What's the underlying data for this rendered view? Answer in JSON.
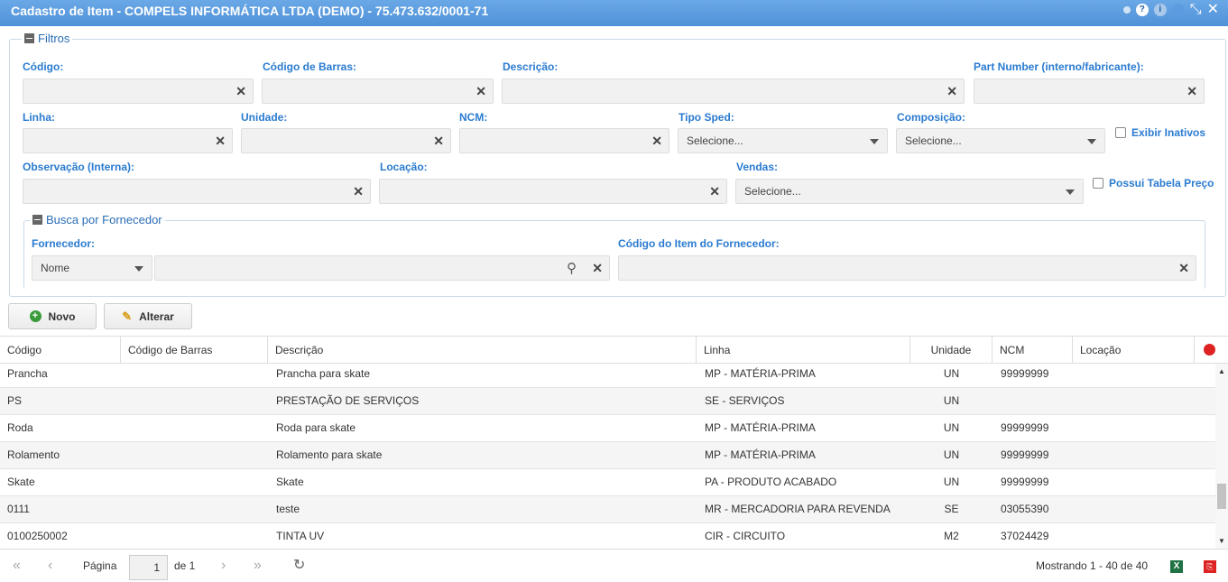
{
  "title": "Cadastro de Item - COMPELS INFORMÁTICA LTDA (DEMO) - 75.473.632/0001-71",
  "filters": {
    "legend": "Filtros",
    "codigo": "Código:",
    "codigo_barras": "Código de Barras:",
    "descricao": "Descrição:",
    "part_number": "Part Number (interno/fabricante):",
    "linha": "Linha:",
    "unidade": "Unidade:",
    "ncm": "NCM:",
    "tipo_sped": "Tipo Sped:",
    "tipo_sped_value": "Selecione...",
    "composicao": "Composição:",
    "composicao_value": "Selecione...",
    "exibir_inativos": "Exibir Inativos",
    "observacao": "Observação (Interna):",
    "locacao": "Locação:",
    "vendas": "Vendas:",
    "vendas_value": "Selecione...",
    "possui_tabela": "Possui Tabela Preço"
  },
  "fornecedor": {
    "legend": "Busca por Fornecedor",
    "fornecedor": "Fornecedor:",
    "tipo_value": "Nome",
    "codigo_item": "Código do Item do Fornecedor:"
  },
  "toolbar": {
    "novo": "Novo",
    "alterar": "Alterar"
  },
  "grid": {
    "headers": [
      "Código",
      "Código de Barras",
      "Descrição",
      "Linha",
      "Unidade",
      "NCM",
      "Locação"
    ],
    "rows": [
      [
        "Prancha",
        "",
        "Prancha para skate",
        "MP - MATÉRIA-PRIMA",
        "UN",
        "99999999",
        ""
      ],
      [
        "PS",
        "",
        "PRESTAÇÃO DE SERVIÇOS",
        "SE - SERVIÇOS",
        "UN",
        "",
        ""
      ],
      [
        "Roda",
        "",
        "Roda para skate",
        "MP - MATÉRIA-PRIMA",
        "UN",
        "99999999",
        ""
      ],
      [
        "Rolamento",
        "",
        "Rolamento para skate",
        "MP - MATÉRIA-PRIMA",
        "UN",
        "99999999",
        ""
      ],
      [
        "Skate",
        "",
        "Skate",
        "PA - PRODUTO ACABADO",
        "UN",
        "99999999",
        ""
      ],
      [
        "0111",
        "",
        "teste",
        "MR - MERCADORIA PARA REVENDA",
        "SE",
        "03055390",
        ""
      ],
      [
        "0100250002",
        "",
        "TINTA UV",
        "CIR - CIRCUITO",
        "M2",
        "37024429",
        ""
      ]
    ]
  },
  "pager": {
    "pagina": "Página",
    "page": "1",
    "de": "de 1",
    "mostrando": "Mostrando 1 - 40 de 40"
  }
}
